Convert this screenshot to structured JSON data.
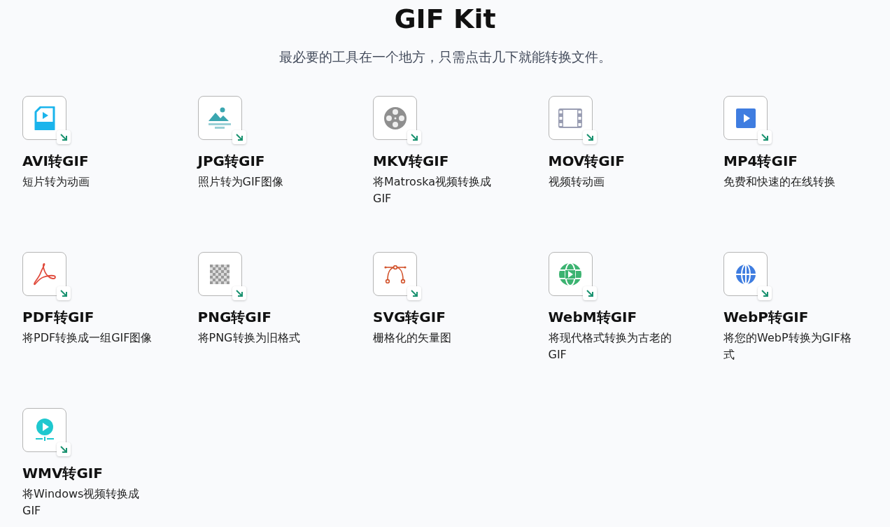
{
  "title": "GIF Kit",
  "subtitle": "最必要的工具在一个地方，只需点击几下就能转换文件。",
  "tools": [
    {
      "kind": "video-file",
      "name": "AVI转GIF",
      "description": "短片转为动画"
    },
    {
      "kind": "image",
      "name": "JPG转GIF",
      "description": "照片转为GIF图像"
    },
    {
      "kind": "reel",
      "name": "MKV转GIF",
      "description": "将Matroska视频转换成GIF"
    },
    {
      "kind": "film",
      "name": "MOV转GIF",
      "description": "视频转动画"
    },
    {
      "kind": "play-square",
      "name": "MP4转GIF",
      "description": "免费和快速的在线转换"
    },
    {
      "kind": "acrobat",
      "name": "PDF转GIF",
      "description": "将PDF转换成一组GIF图像"
    },
    {
      "kind": "checker",
      "name": "PNG转GIF",
      "description": "将PNG转换为旧格式"
    },
    {
      "kind": "bezier",
      "name": "SVG转GIF",
      "description": "栅格化的矢量图"
    },
    {
      "kind": "globe-play",
      "name": "WebM转GIF",
      "description": "将现代格式转换为古老的GIF"
    },
    {
      "kind": "globe",
      "name": "WebP转GIF",
      "description": "将您的WebP转换为GIF格式"
    },
    {
      "kind": "play-circle",
      "name": "WMV转GIF",
      "description": "将Windows视频转换成GIF"
    }
  ]
}
